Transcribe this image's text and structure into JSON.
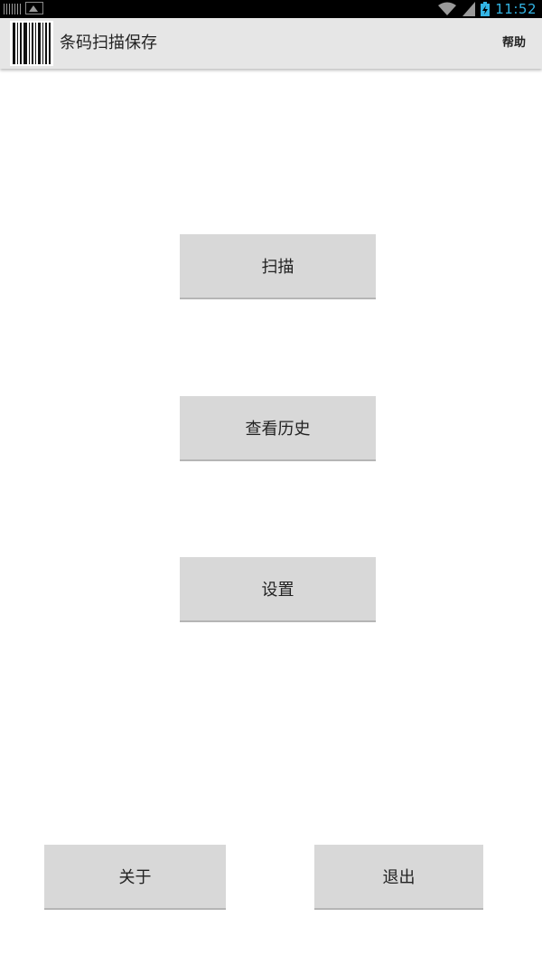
{
  "status_bar": {
    "time": "11:52",
    "icons": [
      "barcode-notification-icon",
      "gallery-notification-icon",
      "wifi-icon",
      "signal-icon",
      "battery-charging-icon"
    ],
    "accent_color": "#33b5e5"
  },
  "action_bar": {
    "app_icon": "barcode-icon",
    "title": "条码扫描保存",
    "help_label": "帮助"
  },
  "main": {
    "scan_label": "扫描",
    "history_label": "查看历史",
    "settings_label": "设置"
  },
  "footer": {
    "about_label": "关于",
    "exit_label": "退出"
  },
  "colors": {
    "action_bar_bg": "#e6e6e6",
    "button_bg": "#d8d8d8",
    "status_bar_bg": "#000000"
  }
}
